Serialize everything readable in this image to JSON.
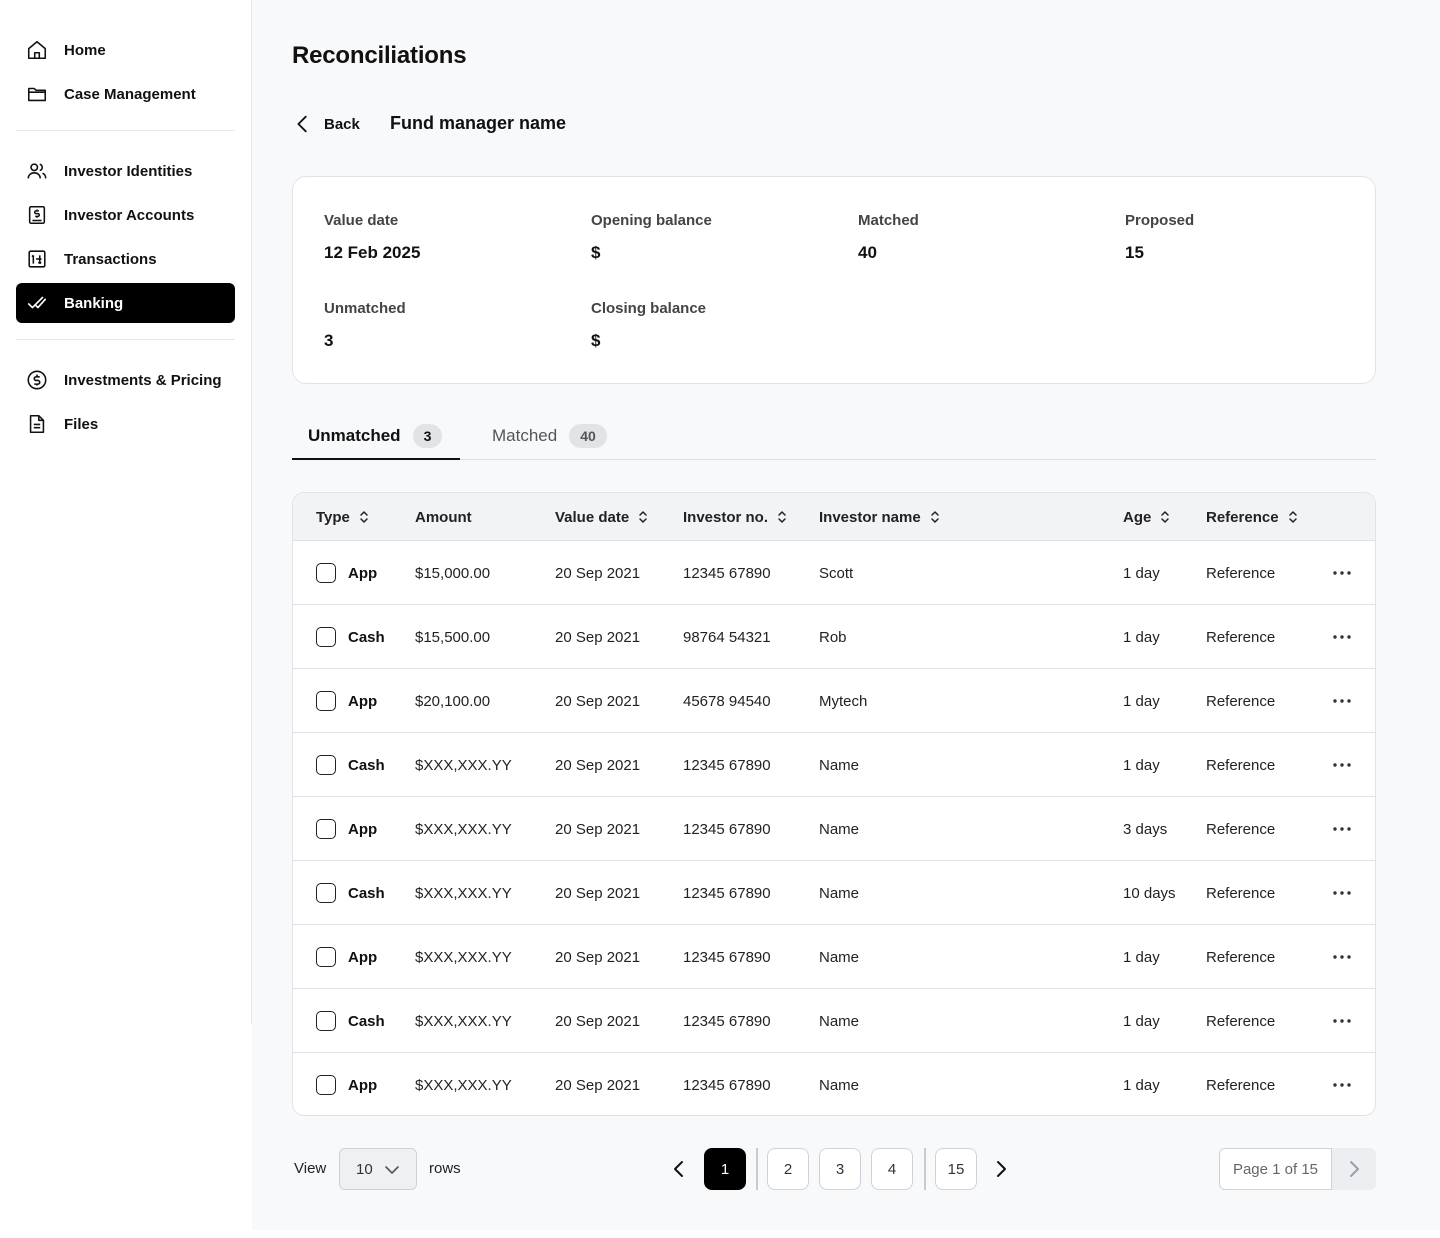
{
  "sidebar": {
    "items": [
      {
        "label": "Home",
        "icon": "home-icon"
      },
      {
        "label": "Case Management",
        "icon": "folder-icon"
      },
      {
        "label": "Investor Identities",
        "icon": "users-icon"
      },
      {
        "label": "Investor Accounts",
        "icon": "account-icon"
      },
      {
        "label": "Transactions",
        "icon": "transactions-icon"
      },
      {
        "label": "Banking",
        "icon": "check-icon",
        "active": true
      },
      {
        "label": "Investments & Pricing",
        "icon": "dollar-icon"
      },
      {
        "label": "Files",
        "icon": "file-icon"
      }
    ]
  },
  "header": {
    "title": "Reconciliations",
    "back_label": "Back",
    "subtitle": "Fund manager name"
  },
  "summary": {
    "value_date": {
      "label": "Value date",
      "value": "12 Feb 2025"
    },
    "opening_balance": {
      "label": "Opening balance",
      "value": "$"
    },
    "matched": {
      "label": "Matched",
      "value": "40"
    },
    "proposed": {
      "label": "Proposed",
      "value": "15"
    },
    "unmatched": {
      "label": "Unmatched",
      "value": "3"
    },
    "closing_balance": {
      "label": "Closing balance",
      "value": "$"
    }
  },
  "tabs": [
    {
      "label": "Unmatched",
      "count": "3",
      "active": true
    },
    {
      "label": "Matched",
      "count": "40",
      "active": false
    }
  ],
  "table": {
    "columns": [
      "Type",
      "Amount",
      "Value date",
      "Investor no.",
      "Investor name",
      "Age",
      "Reference"
    ],
    "rows": [
      {
        "type": "App",
        "amount": "$15,000.00",
        "value_date": "20 Sep 2021",
        "investor_no": "12345 67890",
        "investor_name": "Scott",
        "age": "1 day",
        "reference": "Reference"
      },
      {
        "type": "Cash",
        "amount": "$15,500.00",
        "value_date": "20 Sep 2021",
        "investor_no": "98764 54321",
        "investor_name": "Rob",
        "age": "1 day",
        "reference": "Reference"
      },
      {
        "type": "App",
        "amount": "$20,100.00",
        "value_date": "20 Sep 2021",
        "investor_no": "45678 94540",
        "investor_name": "Mytech",
        "age": "1 day",
        "reference": "Reference"
      },
      {
        "type": "Cash",
        "amount": "$XXX,XXX.YY",
        "value_date": "20 Sep 2021",
        "investor_no": "12345 67890",
        "investor_name": "Name",
        "age": "1 day",
        "reference": "Reference"
      },
      {
        "type": "App",
        "amount": "$XXX,XXX.YY",
        "value_date": "20 Sep 2021",
        "investor_no": "12345 67890",
        "investor_name": "Name",
        "age": "3 days",
        "reference": "Reference"
      },
      {
        "type": "Cash",
        "amount": "$XXX,XXX.YY",
        "value_date": "20 Sep 2021",
        "investor_no": "12345 67890",
        "investor_name": "Name",
        "age": "10 days",
        "reference": "Reference"
      },
      {
        "type": "App",
        "amount": "$XXX,XXX.YY",
        "value_date": "20 Sep 2021",
        "investor_no": "12345 67890",
        "investor_name": "Name",
        "age": "1 day",
        "reference": "Reference"
      },
      {
        "type": "Cash",
        "amount": "$XXX,XXX.YY",
        "value_date": "20 Sep 2021",
        "investor_no": "12345 67890",
        "investor_name": "Name",
        "age": "1 day",
        "reference": "Reference"
      },
      {
        "type": "App",
        "amount": "$XXX,XXX.YY",
        "value_date": "20 Sep 2021",
        "investor_no": "12345 67890",
        "investor_name": "Name",
        "age": "1 day",
        "reference": "Reference"
      }
    ]
  },
  "pagination": {
    "view_label": "View",
    "rows_per_page": "10",
    "rows_label": "rows",
    "pages": [
      "1",
      "2",
      "3",
      "4",
      "15"
    ],
    "current_page": "1",
    "page_info": "Page 1 of 15"
  },
  "colors": {
    "accent": "#000000",
    "background": "#f8f9fb",
    "border": "#e1e3e8"
  }
}
